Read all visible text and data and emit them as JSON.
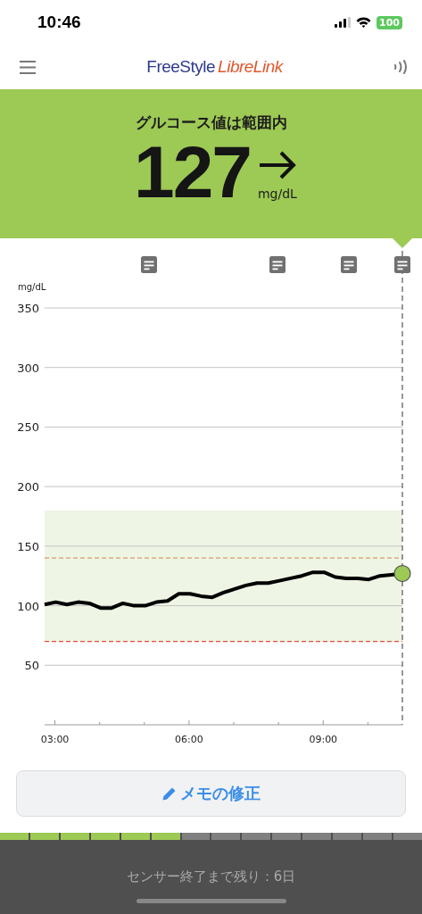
{
  "status_bar": {
    "time": "10:46",
    "battery": "100"
  },
  "nav": {
    "logo_first": "FreeStyle",
    "logo_second": "LibreLink"
  },
  "banner": {
    "message": "グルコース値は範囲内",
    "value": "127",
    "unit": "mg/dL"
  },
  "chart_data": {
    "type": "line",
    "grid": true,
    "ylabel": "mg/dL",
    "xlim": [
      2.77,
      10.77
    ],
    "ylim": [
      0,
      350
    ],
    "xticks": [
      {
        "value": 3,
        "label": "03:00"
      },
      {
        "value": 6,
        "label": "06:00"
      },
      {
        "value": 9,
        "label": "09:00"
      }
    ],
    "yticks": [
      50,
      100,
      150,
      200,
      250,
      300,
      350
    ],
    "x": [
      2.77,
      3.02,
      3.27,
      3.52,
      3.77,
      4.02,
      4.27,
      4.52,
      4.77,
      5.02,
      5.27,
      5.52,
      5.77,
      6.02,
      6.27,
      6.52,
      6.77,
      7.02,
      7.27,
      7.52,
      7.77,
      8.02,
      8.27,
      8.52,
      8.77,
      9.02,
      9.27,
      9.52,
      9.77,
      10.02,
      10.27,
      10.52,
      10.77
    ],
    "series": [
      {
        "color": "#000000",
        "values": [
          101,
          103,
          101,
          103,
          102,
          98,
          98,
          102,
          100,
          100,
          103,
          104,
          110,
          110,
          108,
          107,
          111,
          114,
          117,
          119,
          119,
          121,
          123,
          125,
          128,
          128,
          124,
          123,
          123,
          122,
          125,
          126,
          127
        ]
      }
    ],
    "bands": [
      {
        "axis": "y",
        "from": 70,
        "to": 180,
        "color": "#eef5e4"
      }
    ],
    "ref_lines": [
      {
        "axis": "y",
        "value": 140,
        "color": "#d99a6c"
      },
      {
        "axis": "y",
        "value": 70,
        "color": "#e04a3a"
      }
    ]
  },
  "memo_markers": [
    {
      "kind": "note"
    },
    {
      "kind": "note"
    },
    {
      "kind": "note"
    },
    {
      "kind": "note"
    }
  ],
  "memo_button": {
    "label": "メモの修正"
  },
  "sensor_days": [
    {
      "elapsed": true
    },
    {
      "elapsed": true
    },
    {
      "elapsed": true
    },
    {
      "elapsed": true
    },
    {
      "elapsed": true
    },
    {
      "elapsed": true
    },
    {
      "elapsed": false
    },
    {
      "elapsed": false
    },
    {
      "elapsed": false
    },
    {
      "elapsed": false
    },
    {
      "elapsed": false
    },
    {
      "elapsed": false
    },
    {
      "elapsed": false
    },
    {
      "elapsed": false
    }
  ],
  "footer": {
    "remaining": "センサー終了まで残り：6日"
  }
}
